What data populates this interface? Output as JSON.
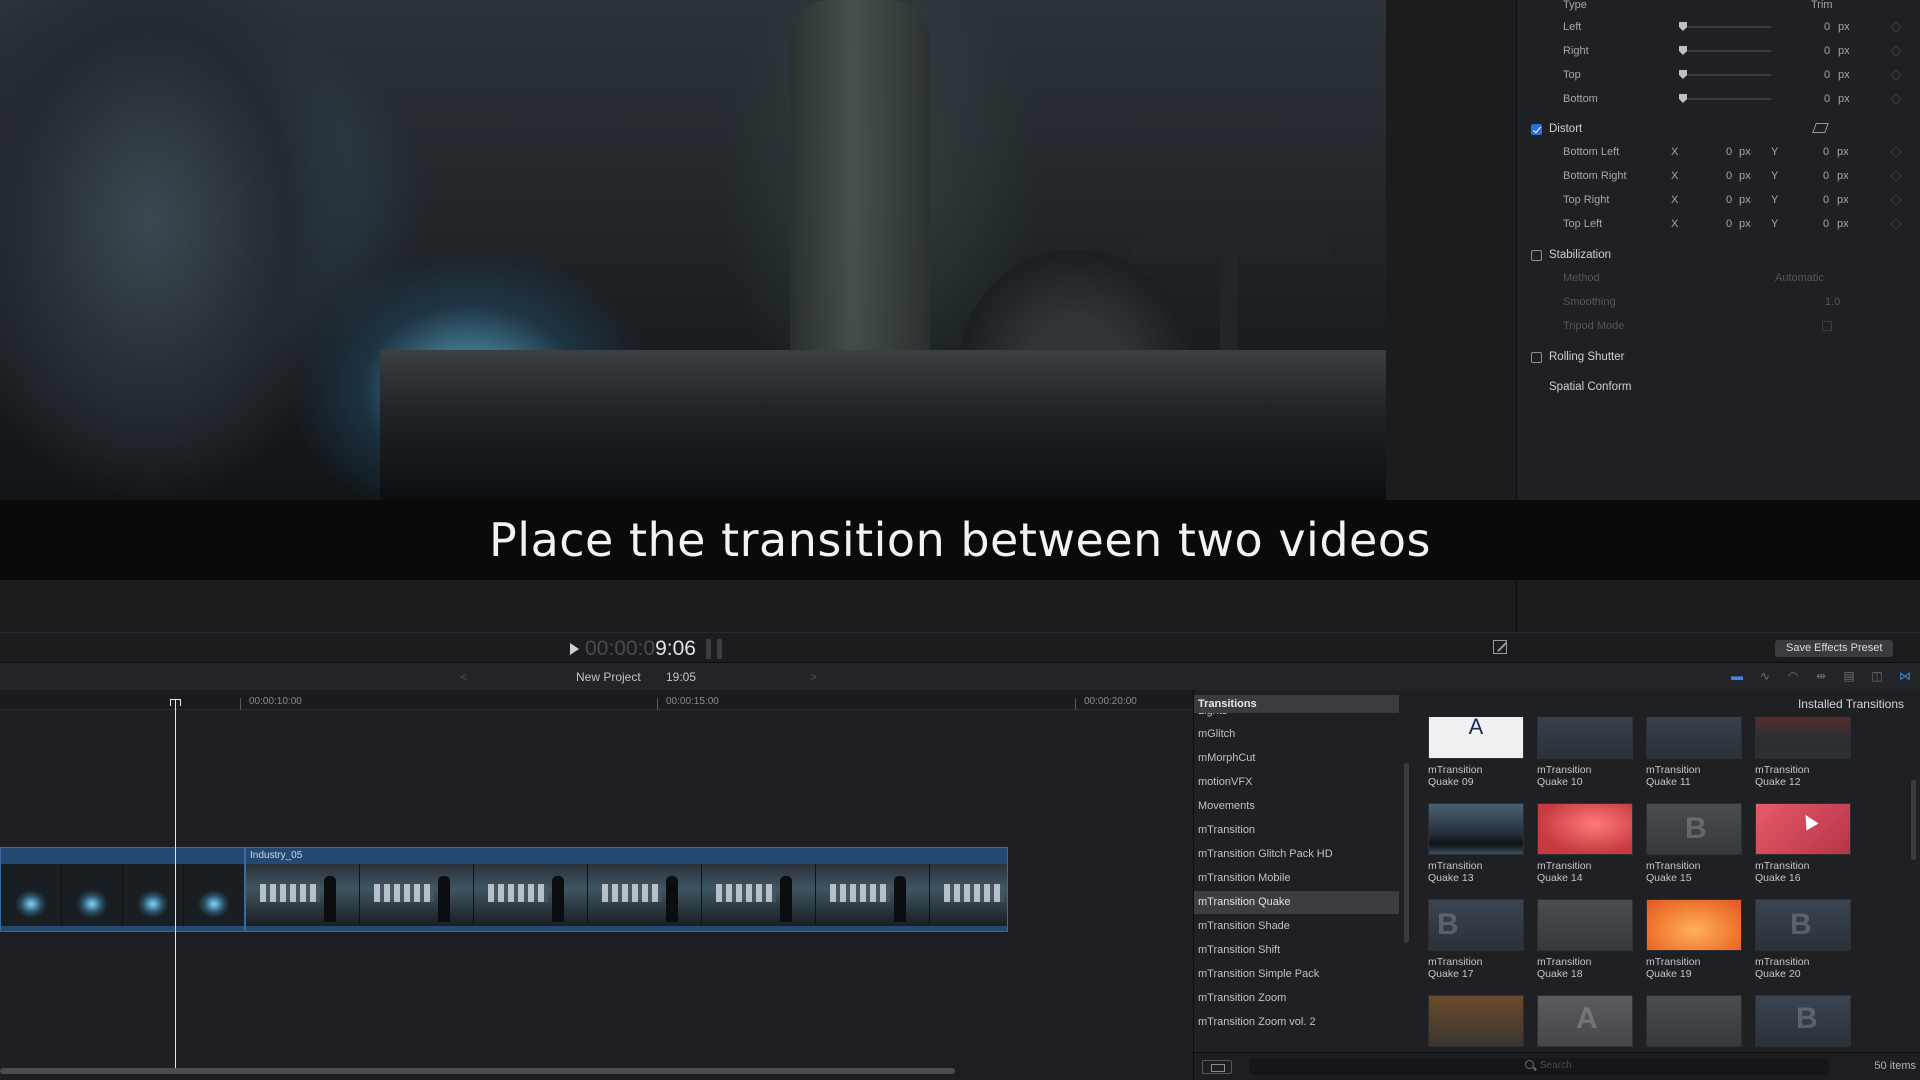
{
  "caption": "Place the transition between two videos",
  "inspector": {
    "type_label": "Type",
    "type_value": "Trim",
    "trim_rows": [
      {
        "label": "Left",
        "value": "0",
        "unit": "px"
      },
      {
        "label": "Right",
        "value": "0",
        "unit": "px"
      },
      {
        "label": "Top",
        "value": "0",
        "unit": "px"
      },
      {
        "label": "Bottom",
        "value": "0",
        "unit": "px"
      }
    ],
    "distort": {
      "label": "Distort",
      "rows": [
        {
          "label": "Bottom Left",
          "x": "0",
          "y": "0"
        },
        {
          "label": "Bottom Right",
          "x": "0",
          "y": "0"
        },
        {
          "label": "Top Right",
          "x": "0",
          "y": "0"
        },
        {
          "label": "Top Left",
          "x": "0",
          "y": "0"
        }
      ],
      "x_label": "X",
      "y_label": "Y",
      "unit": "px"
    },
    "stabilization": {
      "label": "Stabilization",
      "method_label": "Method",
      "method_value": "Automatic",
      "smoothing_label": "Smoothing",
      "smoothing_value": "1.0",
      "tripod_label": "Tripod Mode"
    },
    "rolling_shutter": "Rolling Shutter",
    "spatial_conform": "Spatial Conform"
  },
  "transport": {
    "timecode_dim": "00:00:0",
    "timecode_bright": "9:06",
    "save_preset": "Save Effects Preset"
  },
  "timeline_header": {
    "project": "New Project",
    "duration": "19:05",
    "prev": "<",
    "next": ">"
  },
  "ruler": [
    "00:00:10:00",
    "00:00:15:00",
    "00:00:20:00"
  ],
  "clip": {
    "name": "Industry_05"
  },
  "browser": {
    "header": "Transitions",
    "installed": "Installed Transitions",
    "categories": [
      "Lights",
      "mGlitch",
      "mMorphCut",
      "motionVFX",
      "Movements",
      "mTransition",
      "mTransition Glitch Pack HD",
      "mTransition Mobile",
      "mTransition Quake",
      "mTransition Shade",
      "mTransition Shift",
      "mTransition Simple Pack",
      "mTransition Zoom",
      "mTransition Zoom vol. 2"
    ],
    "selected_category": "mTransition Quake",
    "tiles": [
      {
        "l1": "mTransition",
        "l2": "Quake 09"
      },
      {
        "l1": "mTransition",
        "l2": "Quake 10"
      },
      {
        "l1": "mTransition",
        "l2": "Quake 11"
      },
      {
        "l1": "mTransition",
        "l2": "Quake 12"
      },
      {
        "l1": "mTransition",
        "l2": "Quake 13"
      },
      {
        "l1": "mTransition",
        "l2": "Quake 14"
      },
      {
        "l1": "mTransition",
        "l2": "Quake 15"
      },
      {
        "l1": "mTransition",
        "l2": "Quake 16"
      },
      {
        "l1": "mTransition",
        "l2": "Quake 17"
      },
      {
        "l1": "mTransition",
        "l2": "Quake 18"
      },
      {
        "l1": "mTransition",
        "l2": "Quake 19"
      },
      {
        "l1": "mTransition",
        "l2": "Quake 20"
      }
    ],
    "tile_glyph": "A",
    "search_placeholder": "Search",
    "items_count": "50 items"
  },
  "colors": {
    "accent": "#2c6fd9",
    "selection": "#3c3d42",
    "clip": "#244a72"
  }
}
